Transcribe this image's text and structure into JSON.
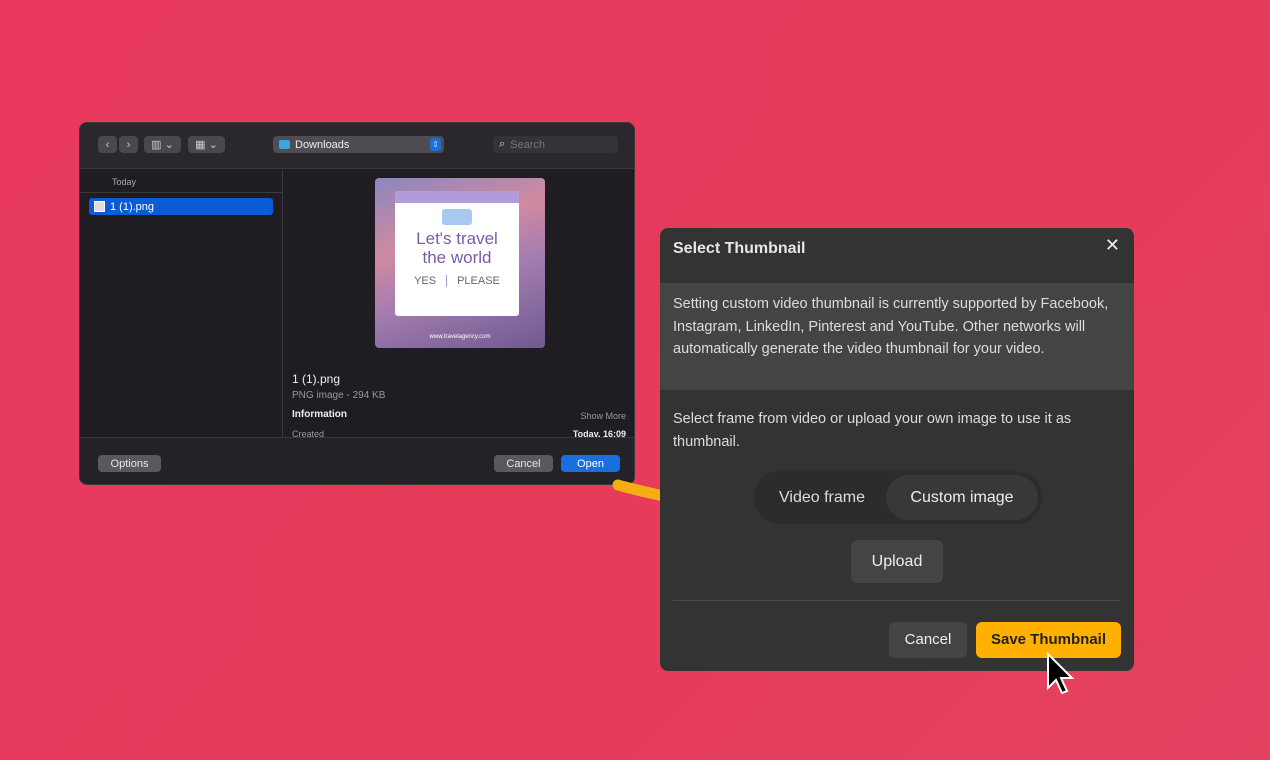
{
  "finder": {
    "location": "Downloads",
    "search_placeholder": "Search",
    "group_label": "Today",
    "file_name": "1 (1).png",
    "preview": {
      "headline_1": "Let's travel",
      "headline_2": "the world",
      "yes": "YES",
      "please": "PLEASE",
      "url": "www.travelagency.com"
    },
    "info_name": "1 (1).png",
    "info_kind": "PNG image - 294 KB",
    "info_heading": "Information",
    "show_more": "Show More",
    "created_label": "Created",
    "created_value": "Today, 16:09",
    "options": "Options",
    "cancel": "Cancel",
    "open": "Open",
    "accent": "#1a6fe0"
  },
  "dialog": {
    "title": "Select Thumbnail",
    "notice": "Setting custom video thumbnail is currently supported by Facebook, Instagram, LinkedIn, Pinterest and YouTube. Other networks will automatically generate the video thumbnail for your video.",
    "instruction": "Select frame from video or upload your own image to use it as thumbnail.",
    "tabs": [
      "Video frame",
      "Custom image"
    ],
    "active_tab": "Custom image",
    "upload": "Upload",
    "cancel": "Cancel",
    "save": "Save Thumbnail",
    "accent": "#ffb000"
  }
}
